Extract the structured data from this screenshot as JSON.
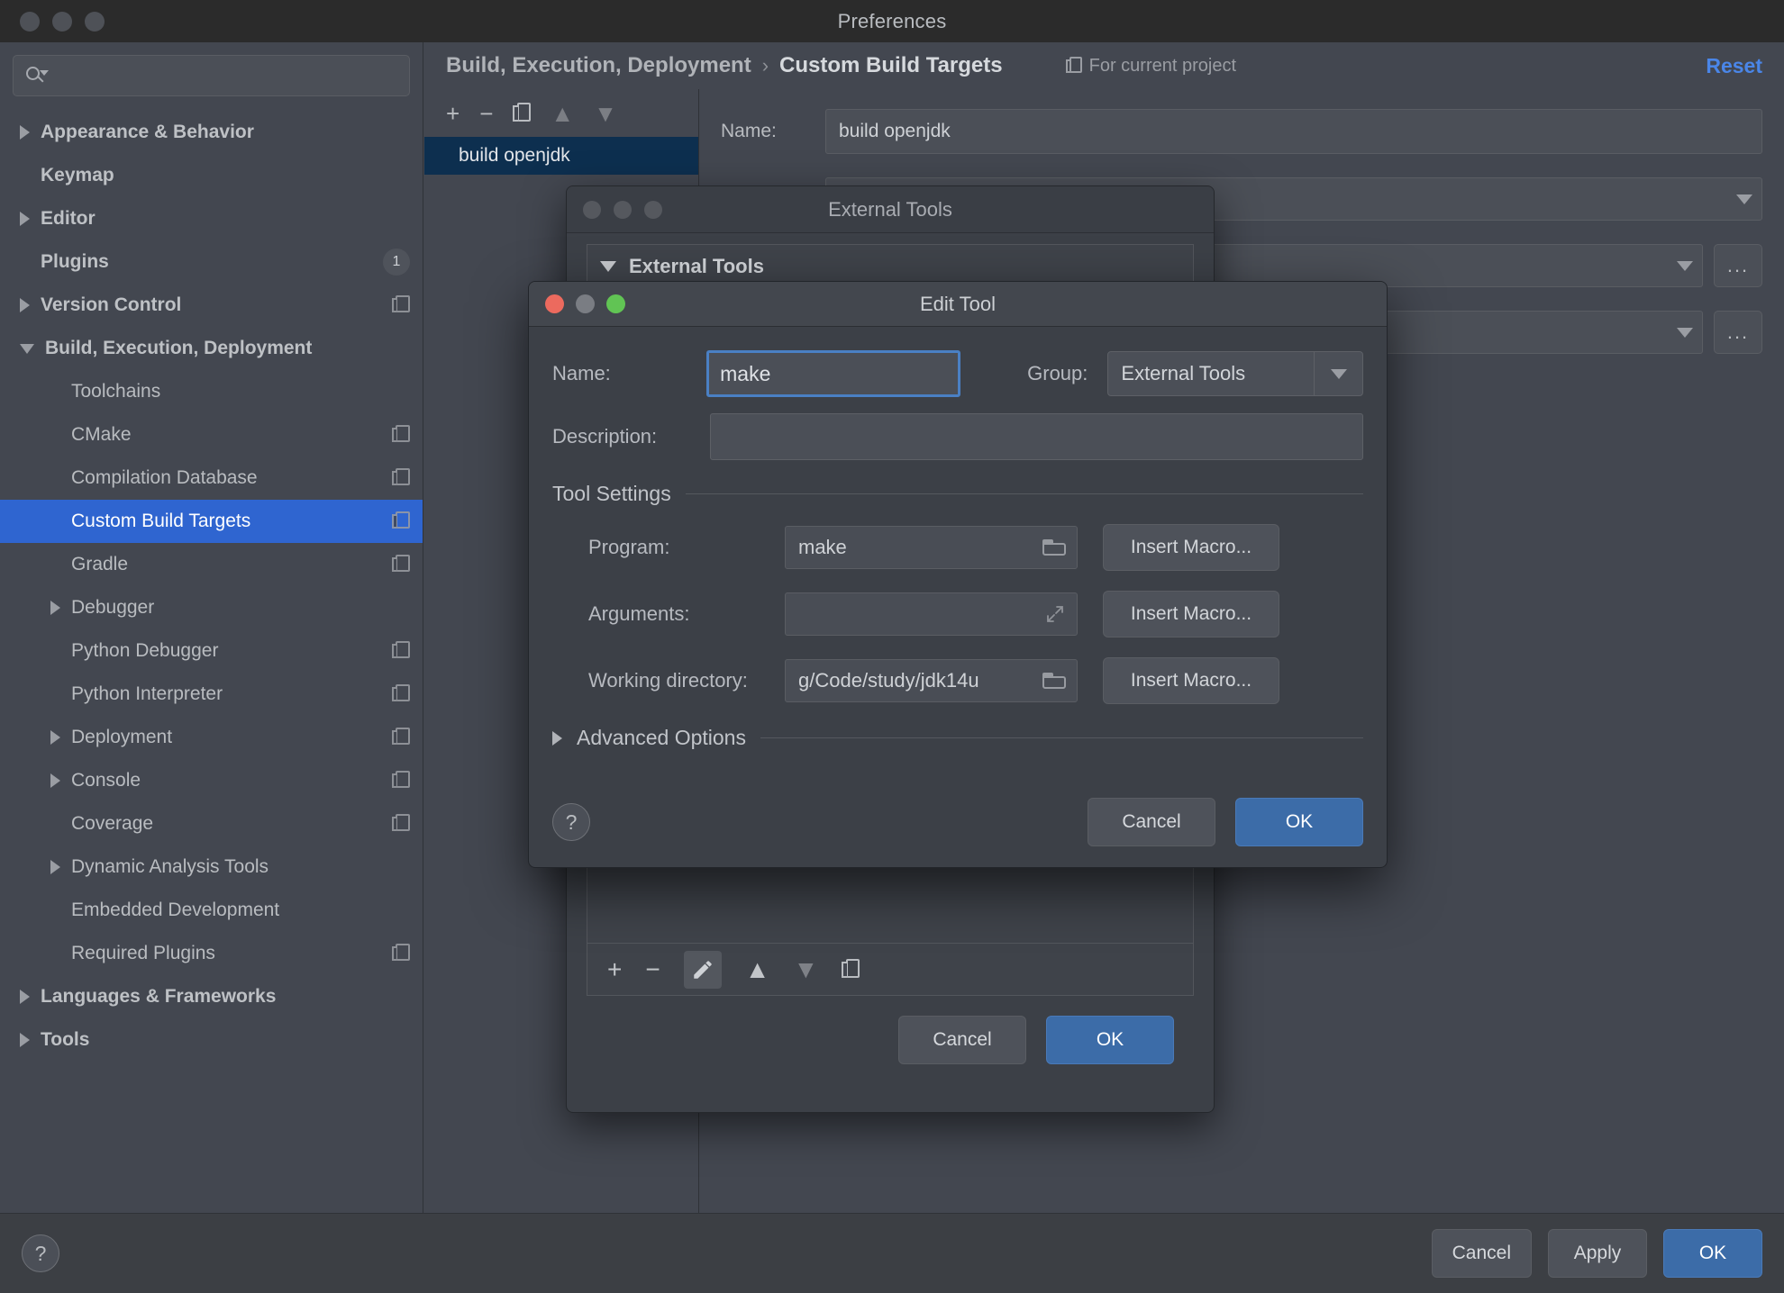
{
  "window": {
    "title": "Preferences"
  },
  "sidebar": {
    "search_placeholder": "",
    "search_value": "",
    "items": [
      {
        "label": "Appearance & Behavior",
        "level": 0,
        "arrow": "right",
        "icon": null,
        "badge": null,
        "selected": false
      },
      {
        "label": "Keymap",
        "level": 0,
        "arrow": "none",
        "icon": null,
        "badge": null,
        "selected": false
      },
      {
        "label": "Editor",
        "level": 0,
        "arrow": "right",
        "icon": null,
        "badge": null,
        "selected": false
      },
      {
        "label": "Plugins",
        "level": 0,
        "arrow": "none",
        "icon": null,
        "badge": "1",
        "selected": false
      },
      {
        "label": "Version Control",
        "level": 0,
        "arrow": "right",
        "icon": "project-scope-icon",
        "badge": null,
        "selected": false
      },
      {
        "label": "Build, Execution, Deployment",
        "level": 0,
        "arrow": "down",
        "icon": null,
        "badge": null,
        "selected": false
      },
      {
        "label": "Toolchains",
        "level": 1,
        "arrow": "none",
        "icon": null,
        "badge": null,
        "selected": false
      },
      {
        "label": "CMake",
        "level": 1,
        "arrow": "none",
        "icon": "project-scope-icon",
        "badge": null,
        "selected": false
      },
      {
        "label": "Compilation Database",
        "level": 1,
        "arrow": "none",
        "icon": "project-scope-icon",
        "badge": null,
        "selected": false
      },
      {
        "label": "Custom Build Targets",
        "level": 1,
        "arrow": "none",
        "icon": "project-scope-icon",
        "badge": null,
        "selected": true
      },
      {
        "label": "Gradle",
        "level": 1,
        "arrow": "none",
        "icon": "project-scope-icon",
        "badge": null,
        "selected": false
      },
      {
        "label": "Debugger",
        "level": 1,
        "arrow": "right",
        "icon": null,
        "badge": null,
        "selected": false
      },
      {
        "label": "Python Debugger",
        "level": 1,
        "arrow": "none",
        "icon": "project-scope-icon",
        "badge": null,
        "selected": false
      },
      {
        "label": "Python Interpreter",
        "level": 1,
        "arrow": "none",
        "icon": "project-scope-icon",
        "badge": null,
        "selected": false
      },
      {
        "label": "Deployment",
        "level": 1,
        "arrow": "right",
        "icon": "project-scope-icon",
        "badge": null,
        "selected": false
      },
      {
        "label": "Console",
        "level": 1,
        "arrow": "right",
        "icon": "project-scope-icon",
        "badge": null,
        "selected": false
      },
      {
        "label": "Coverage",
        "level": 1,
        "arrow": "none",
        "icon": "project-scope-icon",
        "badge": null,
        "selected": false
      },
      {
        "label": "Dynamic Analysis Tools",
        "level": 1,
        "arrow": "right",
        "icon": null,
        "badge": null,
        "selected": false
      },
      {
        "label": "Embedded Development",
        "level": 1,
        "arrow": "none",
        "icon": null,
        "badge": null,
        "selected": false
      },
      {
        "label": "Required Plugins",
        "level": 1,
        "arrow": "none",
        "icon": "project-scope-icon",
        "badge": null,
        "selected": false
      },
      {
        "label": "Languages & Frameworks",
        "level": 0,
        "arrow": "right",
        "icon": null,
        "badge": null,
        "selected": false
      },
      {
        "label": "Tools",
        "level": 0,
        "arrow": "right",
        "icon": null,
        "badge": null,
        "selected": false
      }
    ]
  },
  "header": {
    "breadcrumb_parent": "Build, Execution, Deployment",
    "breadcrumb_separator": "›",
    "breadcrumb_current": "Custom Build Targets",
    "scope_label": "For current project",
    "reset_label": "Reset"
  },
  "targets": {
    "toolbar": {
      "add": "+",
      "remove": "−",
      "copy_icon": "copy-icon",
      "move_up": "▲",
      "move_down": "▼"
    },
    "items": [
      {
        "label": "build openjdk",
        "selected": true
      }
    ]
  },
  "target_fields": {
    "name_label": "Name:",
    "name_value": "build openjdk",
    "dots_label": "..."
  },
  "prefs_footer": {
    "help": "?",
    "cancel": "Cancel",
    "apply": "Apply",
    "ok": "OK"
  },
  "external_tools_dialog": {
    "title": "External Tools",
    "group_label": "External Tools",
    "toolbar": {
      "add": "+",
      "remove": "−",
      "edit_icon": "pencil-icon",
      "move_up": "▲",
      "move_down": "▼",
      "copy_icon": "copy-icon"
    },
    "cancel": "Cancel",
    "ok": "OK"
  },
  "edit_tool_dialog": {
    "title": "Edit Tool",
    "traffic_colors": {
      "close": "#ec6a5e",
      "minimize": "#7a7d83",
      "zoom": "#61c454"
    },
    "name_label": "Name:",
    "name_value": "make",
    "group_label": "Group:",
    "group_value": "External Tools",
    "description_label": "Description:",
    "description_value": "",
    "tool_settings_title": "Tool Settings",
    "fields": [
      {
        "label": "Program:",
        "value": "make",
        "trailing_icon": "folder-icon",
        "macro_button": "Insert Macro..."
      },
      {
        "label": "Arguments:",
        "value": "",
        "trailing_icon": "expand-icon",
        "macro_button": "Insert Macro..."
      },
      {
        "label": "Working directory:",
        "value": "ɡ/Code/study/jdk14u",
        "trailing_icon": "folder-icon",
        "macro_button": "Insert Macro..."
      }
    ],
    "advanced_options_label": "Advanced Options",
    "help": "?",
    "cancel": "Cancel",
    "ok": "OK"
  }
}
